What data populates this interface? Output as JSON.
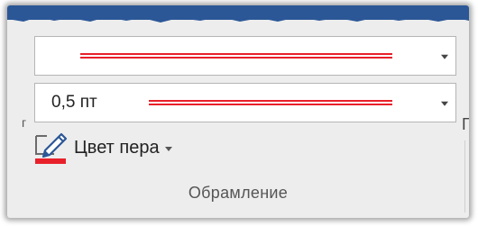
{
  "line_style_dropdown": {
    "value": "",
    "line_color": "#e8202a"
  },
  "line_weight_dropdown": {
    "value": "0,5 пт",
    "line_color": "#e8202a"
  },
  "pen_color": {
    "label": "Цвет пера",
    "swatch_color": "#e8202a",
    "icon": "pen-icon"
  },
  "group": {
    "label": "Обрамление"
  },
  "edge_glyphs": {
    "left": "г",
    "right": "Г"
  },
  "colors": {
    "accent_red": "#e8202a",
    "ribbon_bg": "#ededed",
    "title_band": "#2b5797"
  }
}
